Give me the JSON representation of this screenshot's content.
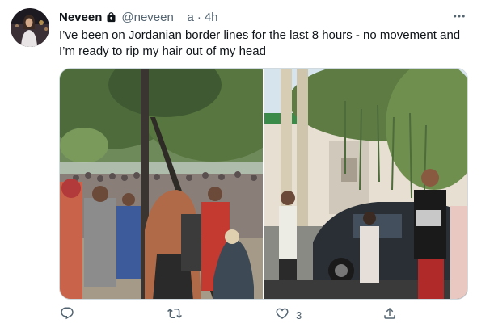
{
  "tweet": {
    "display_name": "Neveen",
    "handle": "@neveen__a",
    "separator": "·",
    "time": "4h",
    "text": "I’ve been on Jordanian border lines for the last 8 hours - no movement and I’m ready to rip my hair out of my head"
  },
  "actions": {
    "reply": {
      "icon": "reply-icon",
      "count": ""
    },
    "retweet": {
      "icon": "retweet-icon",
      "count": ""
    },
    "like": {
      "icon": "like-icon",
      "count": "3"
    },
    "share": {
      "icon": "share-icon",
      "count": ""
    }
  },
  "colors": {
    "text_primary": "#0f1419",
    "text_secondary": "#536471",
    "border": "#cfd9de"
  }
}
